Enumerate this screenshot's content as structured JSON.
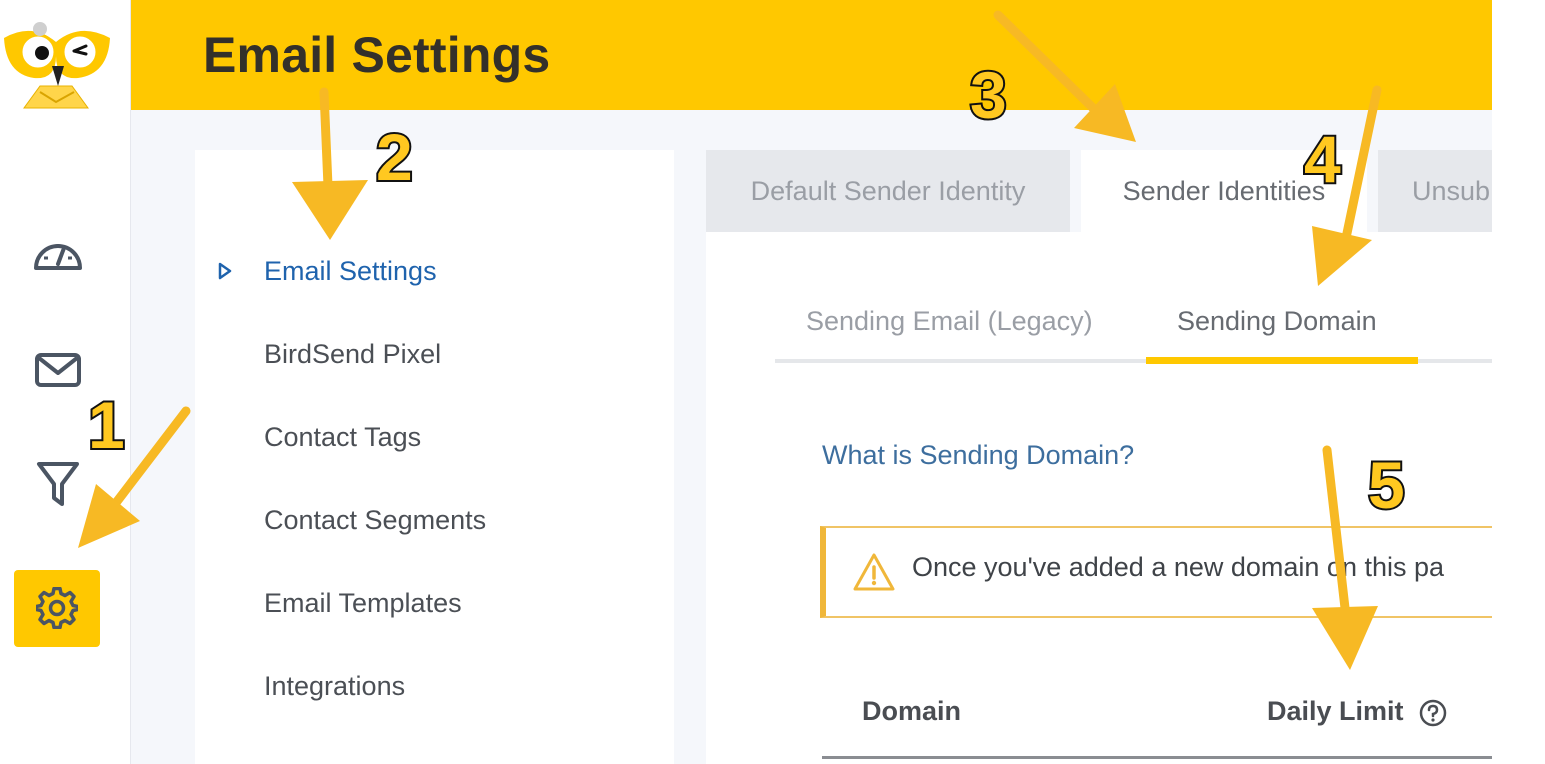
{
  "header": {
    "title": "Email Settings",
    "accent_color": "#ffc800"
  },
  "sidebar": {
    "items": [
      {
        "name": "dashboard",
        "icon": "speedometer-icon"
      },
      {
        "name": "email",
        "icon": "envelope-icon"
      },
      {
        "name": "funnel",
        "icon": "filter-icon"
      },
      {
        "name": "settings",
        "icon": "gear-icon",
        "active": true
      }
    ]
  },
  "settings_menu": {
    "items": [
      {
        "label": "Email Settings",
        "active": true
      },
      {
        "label": "BirdSend Pixel"
      },
      {
        "label": "Contact Tags"
      },
      {
        "label": "Contact Segments"
      },
      {
        "label": "Email Templates"
      },
      {
        "label": "Integrations"
      }
    ]
  },
  "tabs": [
    {
      "label": "Default Sender Identity"
    },
    {
      "label": "Sender Identities",
      "active": true
    },
    {
      "label": "Unsub"
    }
  ],
  "subtabs": [
    {
      "label": "Sending Email (Legacy)"
    },
    {
      "label": "Sending Domain",
      "active": true
    }
  ],
  "help_link": "What is Sending Domain?",
  "warning": {
    "text": "Once you've added a new domain on this pa"
  },
  "table": {
    "headers": [
      "Domain",
      "Daily Limit"
    ]
  },
  "annotations": {
    "labels": [
      "1",
      "2",
      "3",
      "4",
      "5"
    ],
    "color": "#ffc820"
  }
}
